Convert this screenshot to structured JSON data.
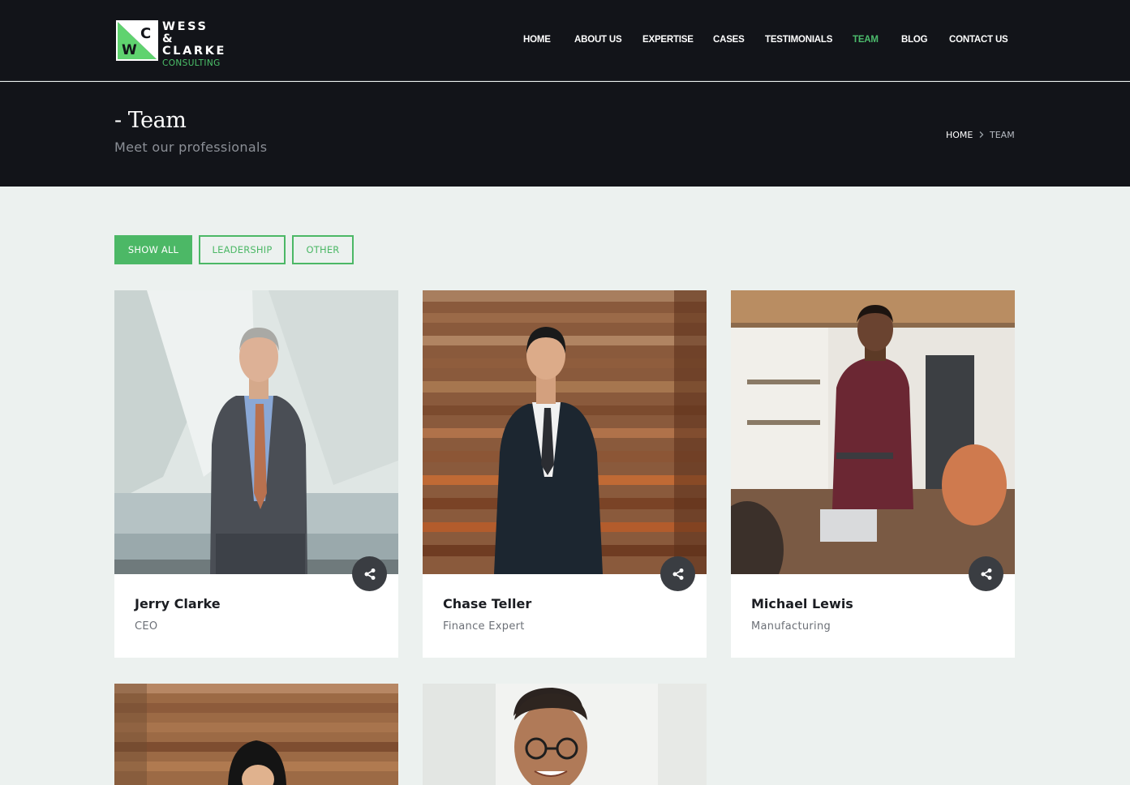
{
  "header": {
    "logo": {
      "mark_letters": [
        "C",
        "W"
      ],
      "lines": [
        "WESS &",
        "CLARKE",
        "CONSULTING"
      ]
    },
    "nav": [
      {
        "label": "HOME",
        "active": false
      },
      {
        "label": "ABOUT US",
        "active": false
      },
      {
        "label": "EXPERTISE",
        "active": false
      },
      {
        "label": "CASES",
        "active": false
      },
      {
        "label": "TESTIMONIALS",
        "active": false
      },
      {
        "label": "TEAM",
        "active": true
      },
      {
        "label": "BLOG",
        "active": false
      },
      {
        "label": "CONTACT US",
        "active": false
      }
    ]
  },
  "page": {
    "title": "- Team",
    "subtitle": "Meet our professionals",
    "breadcrumb": [
      "HOME",
      "TEAM"
    ]
  },
  "filters": [
    {
      "label": "SHOW ALL",
      "active": true
    },
    {
      "label": "LEADERSHIP",
      "active": false
    },
    {
      "label": "OTHER",
      "active": false
    }
  ],
  "team": [
    {
      "name": "Jerry Clarke",
      "role": "CEO",
      "icon": "share-icon"
    },
    {
      "name": "Chase Teller",
      "role": "Finance Expert",
      "icon": "share-icon"
    },
    {
      "name": "Michael Lewis",
      "role": "Manufacturing",
      "icon": "share-icon"
    },
    {
      "name": "",
      "role": ""
    },
    {
      "name": "",
      "role": ""
    }
  ],
  "colors": {
    "accent": "#4cb866",
    "dark": "#121419",
    "background": "#ecf1ef"
  }
}
